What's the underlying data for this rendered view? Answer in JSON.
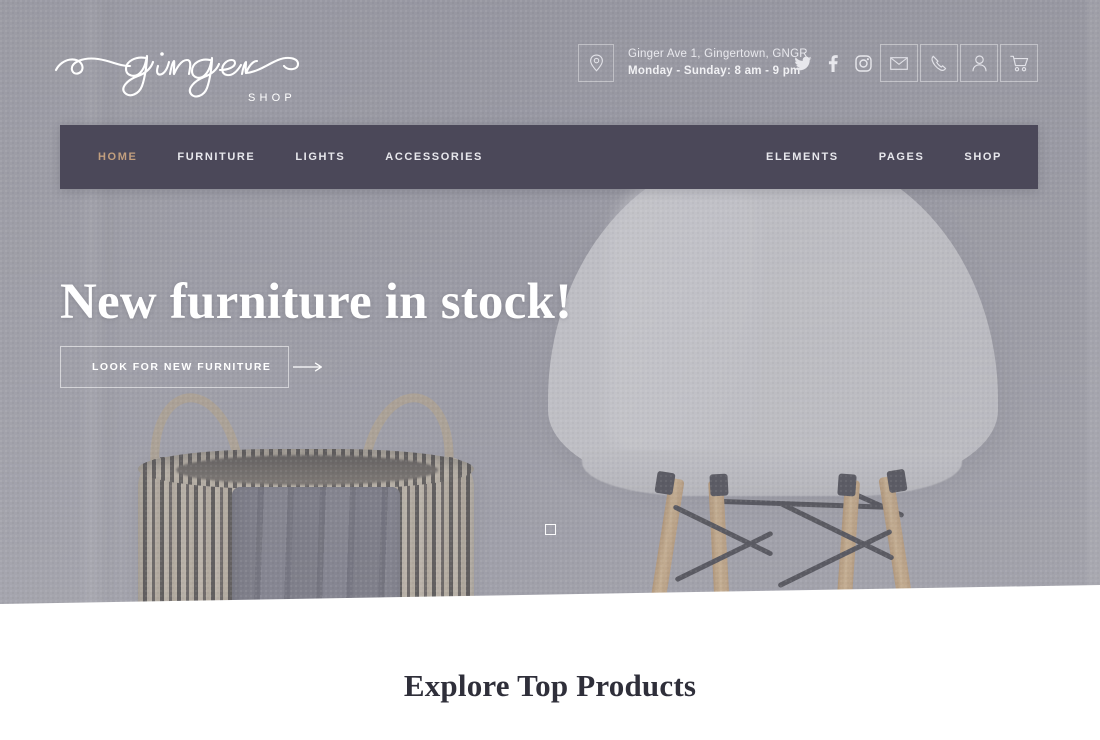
{
  "brand": {
    "name": "ginger",
    "tagline": "SHOP"
  },
  "topbar": {
    "location_icon": "map-pin-icon",
    "address": "Ginger Ave 1, Gingertown, GNGR",
    "hours": "Monday - Sunday: 8 am - 9 pm",
    "social": [
      {
        "name": "twitter-icon",
        "label": "Twitter"
      },
      {
        "name": "facebook-icon",
        "label": "Facebook"
      },
      {
        "name": "instagram-icon",
        "label": "Instagram"
      }
    ],
    "actions": [
      {
        "name": "email-icon",
        "label": "Email"
      },
      {
        "name": "phone-icon",
        "label": "Phone"
      },
      {
        "name": "user-account-icon",
        "label": "Account"
      },
      {
        "name": "shopping-cart-icon",
        "label": "Cart"
      }
    ]
  },
  "nav": {
    "left": [
      {
        "label": "HOME",
        "active": true
      },
      {
        "label": "FURNITURE",
        "active": false
      },
      {
        "label": "LIGHTS",
        "active": false
      },
      {
        "label": "ACCESSORIES",
        "active": false
      }
    ],
    "right": [
      {
        "label": "ELEMENTS"
      },
      {
        "label": "PAGES"
      },
      {
        "label": "SHOP"
      }
    ],
    "bar_color": "#4b4859",
    "active_color": "#c29f7e"
  },
  "hero": {
    "title": "New furniture in stock!",
    "cta_label": "LOOK FOR NEW FURNITURE",
    "cta_arrow_icon": "arrow-right-icon",
    "slides": [
      {
        "active": true
      }
    ]
  },
  "products": {
    "heading": "Explore Top Products"
  }
}
